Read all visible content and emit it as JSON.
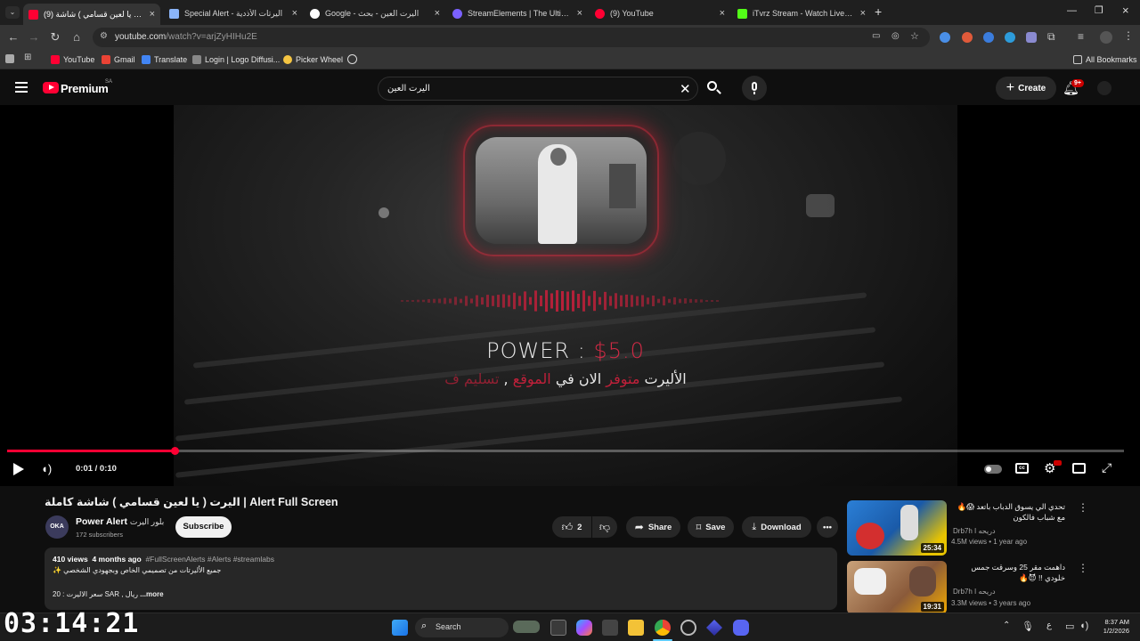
{
  "tabs": [
    {
      "label": "(9) اليرت ( يا لعين قسامي ) شاشة",
      "active": true,
      "color": "#ff0033"
    },
    {
      "label": "Special Alert - اليرتات الأذدية",
      "active": false,
      "color": "#8ab4f8"
    },
    {
      "label": "Google - اليرت العين - بحث",
      "active": false,
      "color": "#4285f4"
    },
    {
      "label": "StreamElements | The Ultimate",
      "active": false,
      "color": "#7b61ff"
    },
    {
      "label": "(9) YouTube",
      "active": false,
      "color": "#ff0033"
    },
    {
      "label": "iTvrz Stream - Watch Live on Ki",
      "active": false,
      "color": "#53fc18"
    }
  ],
  "browser": {
    "url_host": "youtube.com",
    "url_path": "/watch?v=arjZyHIHu2E",
    "bookmarks": [
      "YouTube",
      "Gmail",
      "Translate",
      "Login | Logo Diffusi...",
      "Picker Wheel"
    ],
    "all_bookmarks": "All Bookmarks"
  },
  "yt_header": {
    "logo": "Premium",
    "region": "SA",
    "search_query": "اليرت العين",
    "create_label": "Create",
    "notif_badge": "9+"
  },
  "video": {
    "power_label": "POWER : ",
    "power_amount": "$5.0",
    "overlay_white1": "الأليرت ",
    "overlay_red1": "متوفر ",
    "overlay_white2": "الان في ",
    "overlay_red2": "الموقع",
    "overlay_white3": " , ",
    "overlay_red3": "تسليم ف",
    "time": "0:01 / 0:10",
    "progress": 0.15
  },
  "info": {
    "title": "اليرت ( يا لعين قسامي ) شاشة كاملة | Alert Full Screen",
    "channel_name": "Power Alert",
    "channel_name_ar": "بلور اليرت",
    "subscribers": "172 subscribers",
    "avatar_text": "OKA",
    "subscribe_label": "Subscribe",
    "likes": "2",
    "share_label": "Share",
    "save_label": "Save",
    "download_label": "Download"
  },
  "description": {
    "views": "410 views",
    "age": "4 months ago",
    "hashtags": "#FullScreenAlerts #Alerts #streamlabs",
    "line1": "جميع الأليرتات من تصميمي الخاص وبجهودي الشخصي ✨",
    "line2": "سعر الاليرت : 20 SAR , ريال",
    "more": "...more"
  },
  "recommendations": [
    {
      "title": "تحدي الي يسوق الدباب باتعد 😱🔥 مع شباب فالكون",
      "channel": "Drb7h I دريحه",
      "meta": "4.5M views • 1 year ago",
      "duration": "25:34"
    },
    {
      "title": "داهمت مقر 25 وسرقت جمس خلودي !! 😈🔥",
      "channel": "Drb7h I دريحه",
      "meta": "3.3M views • 3 years ago",
      "duration": "19:31"
    }
  ],
  "taskbar": {
    "search_label": "Search",
    "clock_time": "8:37 AM",
    "clock_date": "1/2/2026",
    "lang": "ع"
  },
  "overlay_timer": "03:14:21"
}
